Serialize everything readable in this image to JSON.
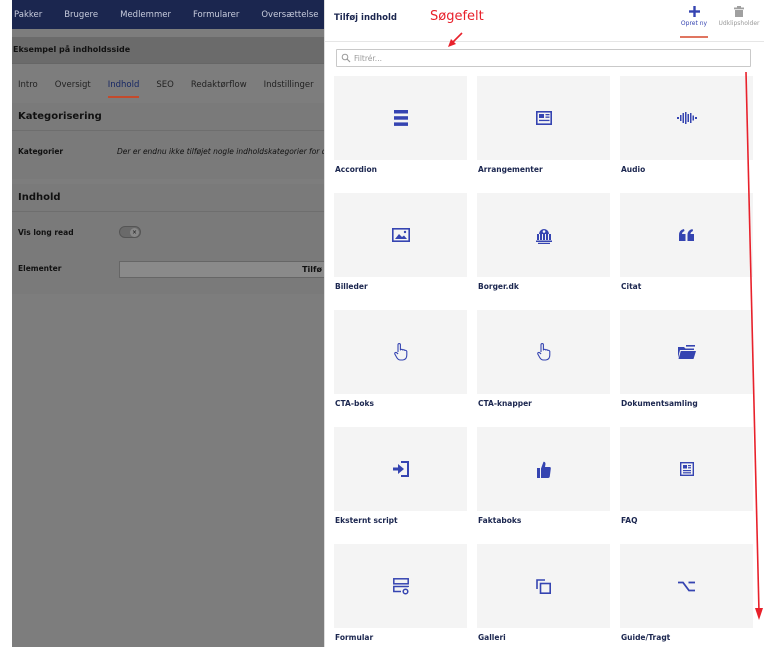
{
  "background_page": {
    "top_nav": [
      "Pakker",
      "Brugere",
      "Medlemmer",
      "Formularer",
      "Oversættelse"
    ],
    "page_title": "Eksempel på indholdsside",
    "tabs": [
      {
        "label": "Intro",
        "active": false
      },
      {
        "label": "Oversigt",
        "active": false
      },
      {
        "label": "Indhold",
        "active": true
      },
      {
        "label": "SEO",
        "active": false
      },
      {
        "label": "Redaktørflow",
        "active": false
      },
      {
        "label": "Indstillinger",
        "active": false
      }
    ],
    "categorization": {
      "title": "Kategorisering",
      "label": "Kategorier",
      "value": "Der er endnu ikke tilføjet nogle indholdskategorier for dette"
    },
    "content": {
      "title": "Indhold",
      "long_read_label": "Vis long read",
      "toggle_symbol": "×",
      "elements_label": "Elementer",
      "add_text": "Tilfø"
    }
  },
  "drawer": {
    "title": "Tilføj indhold",
    "annotation": "Søgefelt",
    "create_new_label": "Opret ny",
    "clipboard_label": "Udklipsholder",
    "filter_placeholder": "Filtrér...",
    "accent_color": "#3544b1",
    "annotation_color": "#e8212b",
    "items": [
      {
        "label": "Accordion",
        "icon": "list-icon"
      },
      {
        "label": "Arrangementer",
        "icon": "newspaper-icon"
      },
      {
        "label": "Audio",
        "icon": "audio-wave-icon"
      },
      {
        "label": "Billeder",
        "icon": "image-icon"
      },
      {
        "label": "Borger.dk",
        "icon": "government-building-icon"
      },
      {
        "label": "Citat",
        "icon": "quote-icon"
      },
      {
        "label": "CTA-boks",
        "icon": "pointer-hand-icon"
      },
      {
        "label": "CTA-knapper",
        "icon": "pointer-hand-icon"
      },
      {
        "label": "Dokumentsamling",
        "icon": "folder-open-icon"
      },
      {
        "label": "Eksternt script",
        "icon": "sign-in-icon"
      },
      {
        "label": "Faktaboks",
        "icon": "thumbs-up-icon"
      },
      {
        "label": "FAQ",
        "icon": "document-list-icon"
      },
      {
        "label": "Formular",
        "icon": "form-settings-icon"
      },
      {
        "label": "Galleri",
        "icon": "gallery-copy-icon"
      },
      {
        "label": "Guide/Tragt",
        "icon": "option-key-icon"
      }
    ]
  }
}
